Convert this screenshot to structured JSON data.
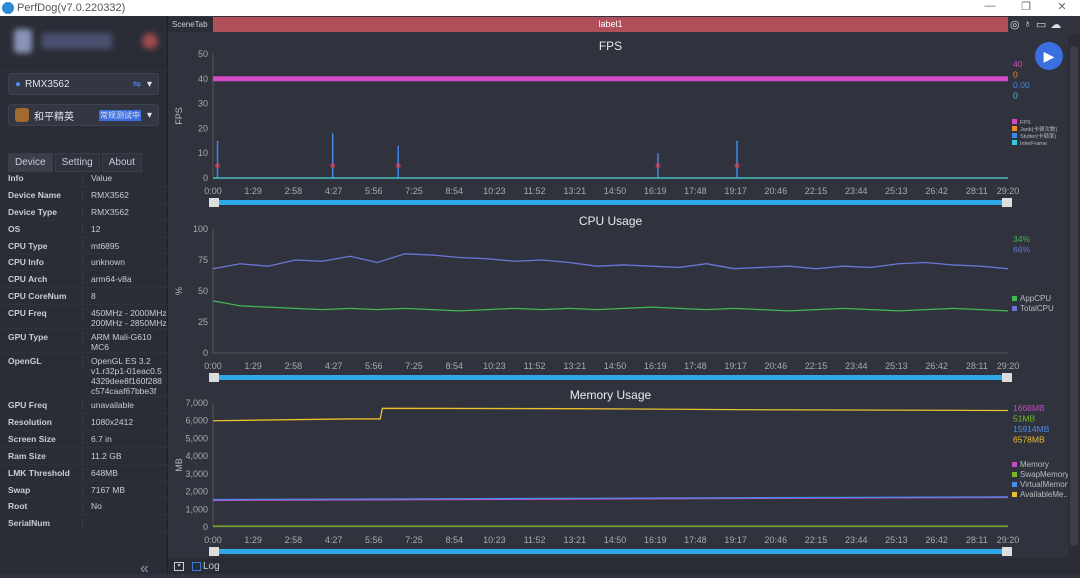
{
  "app": {
    "title": "PerfDog(v7.0.220332)",
    "min": "—",
    "max": "❐",
    "close": "✕"
  },
  "sidebar": {
    "device_select": "RMX3562",
    "app_select": "和平精英",
    "app_badge": "常规测试中",
    "tabs": [
      "Device",
      "Setting",
      "About"
    ],
    "info_header": [
      "Info",
      "Value"
    ],
    "info": [
      [
        "Device Name",
        "RMX3562"
      ],
      [
        "Device Type",
        "RMX3562"
      ],
      [
        "OS",
        "12"
      ],
      [
        "CPU Type",
        "mt6895"
      ],
      [
        "CPU Info",
        "unknown"
      ],
      [
        "CPU Arch",
        "arm64-v8a"
      ],
      [
        "CPU CoreNum",
        "8"
      ],
      [
        "CPU Freq",
        "450MHz - 2000MHz\n200MHz - 2850MHz"
      ],
      [
        "GPU Type",
        "ARM Mali-G610\nMC6"
      ],
      [
        "OpenGL",
        "OpenGL ES 3.2\nv1.r32p1-01eac0.5\n4329dee8f160f288\nc574caaf67bbe3f"
      ],
      [
        "GPU Freq",
        "unavailable"
      ],
      [
        "Resolution",
        "1080x2412"
      ],
      [
        "Screen Size",
        "6.7 in"
      ],
      [
        "Ram Size",
        "11.2 GB"
      ],
      [
        "LMK Threshold",
        "648MB"
      ],
      [
        "Swap",
        "7167 MB"
      ],
      [
        "Root",
        "No"
      ],
      [
        "SerialNum",
        ""
      ]
    ],
    "collapse_icon": "«"
  },
  "main": {
    "scene_tab": "SceneTab",
    "label": "label1",
    "icons": [
      "location-icon",
      "pin-icon",
      "folder-icon",
      "cloud-icon"
    ]
  },
  "bottom": {
    "log_label": "Log"
  },
  "colors": {
    "fps": "#d64bc4",
    "jank": "#f08a2a",
    "stutter": "#3f86e8",
    "interframe": "#2fcde0",
    "appcpu": "#3fb852",
    "totalcpu": "#6b76d8",
    "memory": "#c44cc0",
    "swap": "#7ab82a",
    "virtual": "#4a8ae8",
    "available": "#e8c030"
  },
  "chart_data": [
    {
      "type": "line",
      "title": "FPS",
      "ylabel": "FPS",
      "ylim": [
        0,
        50
      ],
      "yticks": [
        0,
        10,
        20,
        30,
        40,
        50
      ],
      "xticks": [
        "0:00",
        "1:29",
        "2:58",
        "4:27",
        "5:56",
        "7:25",
        "8:54",
        "10:23",
        "11:52",
        "13:21",
        "14:50",
        "16:19",
        "17:48",
        "19:17",
        "20:46",
        "22:15",
        "23:44",
        "25:13",
        "26:42",
        "28:11",
        "29:20"
      ],
      "xrange_s": [
        0,
        1760
      ],
      "series": [
        {
          "name": "FPS",
          "current": "40",
          "t": [
            0,
            300,
            600,
            900,
            1200,
            1500,
            1760
          ],
          "values": [
            40,
            40,
            40,
            40,
            40,
            40,
            40
          ]
        },
        {
          "name": "Jank(卡顿次数)",
          "current": "0",
          "t": [
            0,
            1760
          ],
          "values": [
            0,
            0
          ]
        },
        {
          "name": "Stutter(卡顿率)",
          "current": "0.00",
          "t": [
            10,
            265,
            410,
            985,
            1160
          ],
          "values": [
            15,
            18,
            13,
            10,
            15
          ]
        },
        {
          "name": "InterFrame",
          "current": "0",
          "t": [
            0,
            1760
          ],
          "values": [
            0,
            0
          ]
        }
      ]
    },
    {
      "type": "line",
      "title": "CPU Usage",
      "ylabel": "%",
      "ylim": [
        0,
        100
      ],
      "yticks": [
        0,
        25,
        50,
        75,
        100
      ],
      "xticks": [
        "0:00",
        "1:29",
        "2:58",
        "4:27",
        "5:56",
        "7:25",
        "8:54",
        "10:23",
        "11:52",
        "13:21",
        "14:50",
        "16:19",
        "17:48",
        "19:17",
        "20:46",
        "22:15",
        "23:44",
        "25:13",
        "26:42",
        "28:11",
        "29:20"
      ],
      "xrange_s": [
        0,
        1760
      ],
      "series": [
        {
          "name": "AppCPU",
          "current": "34%",
          "values": [
            42,
            38,
            37,
            36,
            35,
            36,
            35,
            36,
            35,
            34,
            35,
            36,
            35,
            36,
            35,
            36,
            37,
            36,
            35,
            36,
            35,
            34,
            35,
            36,
            35,
            34,
            35,
            36,
            35,
            34
          ]
        },
        {
          "name": "TotalCPU",
          "current": "66%",
          "values": [
            68,
            72,
            70,
            75,
            74,
            78,
            73,
            80,
            79,
            77,
            76,
            74,
            75,
            73,
            70,
            71,
            70,
            69,
            72,
            68,
            69,
            70,
            68,
            70,
            69,
            72,
            73,
            71,
            70,
            68
          ]
        }
      ]
    },
    {
      "type": "line",
      "title": "Memory Usage",
      "ylabel": "MB",
      "ylim": [
        0,
        7000
      ],
      "yticks": [
        "0",
        "1,000",
        "2,000",
        "3,000",
        "4,000",
        "5,000",
        "6,000",
        "7,000"
      ],
      "xticks": [
        "0:00",
        "1:29",
        "2:58",
        "4:27",
        "5:56",
        "7:25",
        "8:54",
        "10:23",
        "11:52",
        "13:21",
        "14:50",
        "16:19",
        "17:48",
        "19:17",
        "20:46",
        "22:15",
        "23:44",
        "25:13",
        "26:42",
        "28:11",
        "29:20"
      ],
      "xrange_s": [
        0,
        1760
      ],
      "series": [
        {
          "name": "Memory",
          "current": "1668MB",
          "t": [
            0,
            1760
          ],
          "values": [
            1500,
            1668
          ]
        },
        {
          "name": "SwapMemory",
          "current": "51MB",
          "t": [
            0,
            1760
          ],
          "values": [
            51,
            51
          ]
        },
        {
          "name": "VirtualMemory",
          "current": "15914MB",
          "t": [
            0,
            1760
          ],
          "values": [
            1550,
            1700
          ]
        },
        {
          "name": "AvailableMe...",
          "current": "6578MB",
          "t": [
            0,
            150,
            300,
            370,
            375,
            800,
            1200,
            1760
          ],
          "values": [
            6000,
            6050,
            6100,
            6100,
            6700,
            6680,
            6620,
            6578
          ]
        }
      ]
    }
  ]
}
